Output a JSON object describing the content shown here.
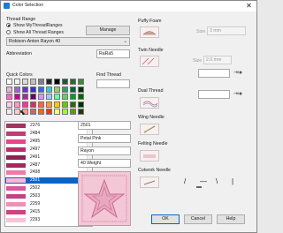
{
  "window": {
    "title": "Color Selection",
    "close_glyph": "✕"
  },
  "thread_range": {
    "heading": "Thread Range",
    "options": [
      "Show MyThreadRanges",
      "Show All Thread Ranges"
    ],
    "selected_option": 0,
    "manage_label": "Manage",
    "range_value": "Robison-Anton Rayon 40",
    "abbreviation_label": "Abbreviation",
    "abbreviation_value": "RaRa5"
  },
  "quick_colors": {
    "heading": "Quick Colors",
    "find_thread_label": "Find Thread",
    "swatches": [
      [
        "#ffffff",
        "#f2f2f2",
        "#d9d9d9",
        "#bfbfbf",
        "#7f7f7f",
        "#262626",
        "#000000",
        "#1d5a2a",
        "#256b34",
        "#3a8a3c"
      ],
      [
        "#e6b3d9",
        "#9966cc",
        "#6633cc",
        "#3333cc",
        "#3366ff",
        "#33cccc",
        "#99cc66",
        "#339966",
        "#006633",
        "#003300"
      ],
      [
        "#ff66cc",
        "#cc0099",
        "#993399",
        "#660066",
        "#cc99ff",
        "#99ccff",
        "#66ff99",
        "#66cc66",
        "#009933",
        "#006600"
      ],
      [
        "#ffcce6",
        "#ff99cc",
        "#ff3399",
        "#cc3366",
        "#ff6633",
        "#ff9933",
        "#ffcc00",
        "#66cc00",
        "#336600",
        "#003300"
      ],
      [
        "#ffe6f2",
        "#ffcccc",
        "#ff9999",
        "#cc6666",
        "#ff6600",
        "#ff3300",
        "#ffff66",
        "#99ff33",
        "#669900",
        "#1f3d00"
      ]
    ]
  },
  "thread_list": {
    "items": [
      {
        "code": "2376",
        "color": "#a1355c"
      },
      {
        "code": "2484",
        "color": "#c23c73"
      },
      {
        "code": "2495",
        "color": "#e6468a"
      },
      {
        "code": "2497",
        "color": "#b8306b"
      },
      {
        "code": "2491",
        "color": "#8c2152"
      },
      {
        "code": "2487",
        "color": "#9e2a5e"
      },
      {
        "code": "2498",
        "color": "#f07aa8"
      },
      {
        "code": "2501",
        "color": "#ffb6d1"
      },
      {
        "code": "2502",
        "color": "#e0559b"
      },
      {
        "code": "2503",
        "color": "#c44188"
      },
      {
        "code": "2259",
        "color": "#f08fb8"
      },
      {
        "code": "2415",
        "color": "#d63f84"
      },
      {
        "code": "2293",
        "color": "#f9c3d8"
      }
    ],
    "selected_index": 7
  },
  "details": {
    "code": "2501",
    "name": "Petal Pink",
    "material": "Rayon",
    "weight": "40 Weight"
  },
  "right_panel": {
    "puffy_foam": {
      "heading": "Puffy Foam",
      "size_label": "Size",
      "size_value": "3 mm"
    },
    "twin_needle": {
      "heading": "Twin Needle",
      "size_label": "Size",
      "size_value": "2.0 mm"
    },
    "dual_thread": {
      "heading": "Dual Thread"
    },
    "wing_needle": {
      "heading": "Wing Needle"
    },
    "felting_needle": {
      "heading": "Felting Needle"
    },
    "cutwork_needle": {
      "heading": "Cutwork Needle",
      "symbols": [
        "/",
        "—",
        "\\",
        "|"
      ]
    }
  },
  "buttons": {
    "ok": "OK",
    "cancel": "Cancel",
    "help": "Help"
  },
  "colors": {
    "accent": "#0a64c8",
    "preview_pink": "#f3c7d6"
  }
}
